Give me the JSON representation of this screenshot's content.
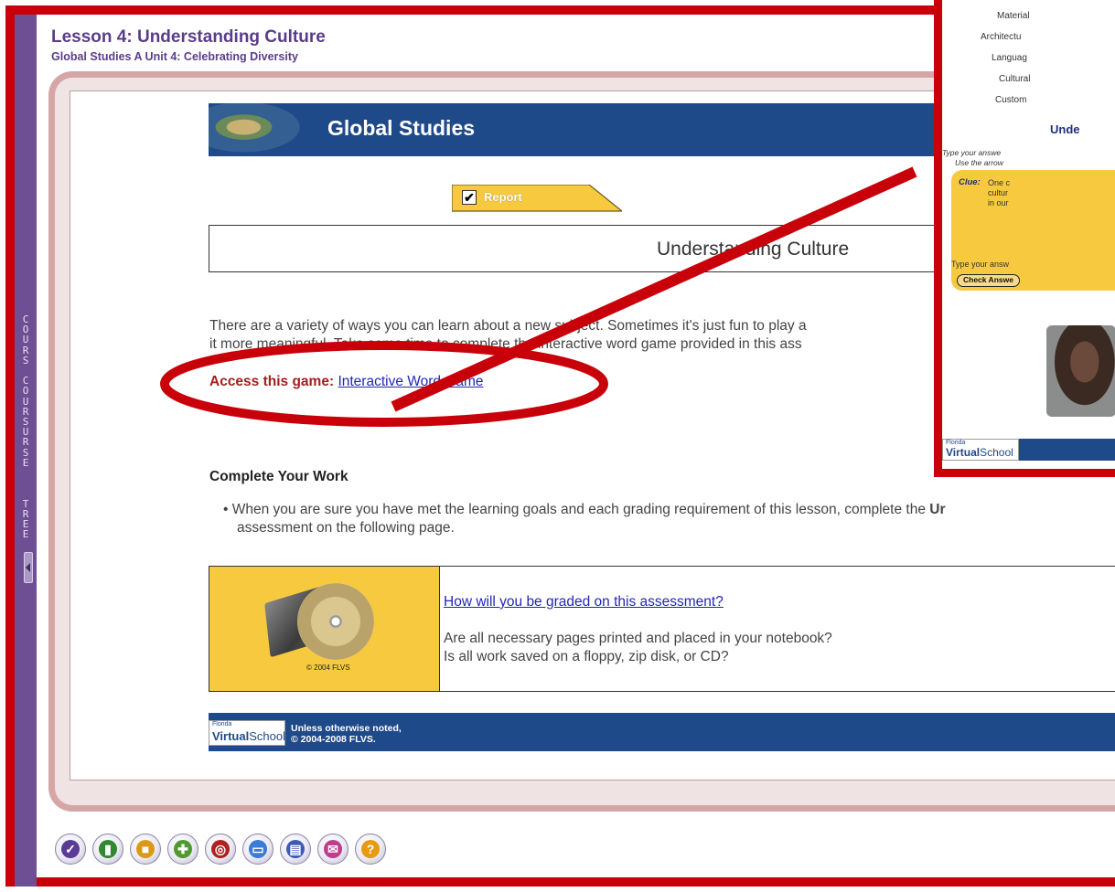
{
  "course_tree": {
    "label_letters": [
      "C",
      "O",
      "U",
      "R",
      "S",
      "",
      "C",
      "O",
      "U",
      "R",
      "S",
      "U",
      "R",
      "S",
      "E",
      "",
      "",
      "",
      "T",
      "R",
      "E",
      "E"
    ]
  },
  "lesson": {
    "title": "Lesson 4: Understanding Culture",
    "subtitle": "Global Studies A  Unit 4: Celebrating Diversity"
  },
  "banner": {
    "title": "Global Studies"
  },
  "report_tab": {
    "label": "Report",
    "checkmark": "✔"
  },
  "section_title": "Understanding Culture",
  "intro": {
    "line1": "There are a variety of ways you can learn about a new subject. Sometimes it's just fun to play a",
    "line2": "it more meaningful. Take some time to complete the interactive word game provided in this ass"
  },
  "access": {
    "label": "Access this game:",
    "link": "Interactive Word Game"
  },
  "complete": {
    "heading": "Complete Your Work",
    "bullet_line1": "• When you are sure you have met the learning goals and each grading requirement of this lesson, complete the ",
    "bullet_bold": "Ur",
    "bullet_line2": "assessment on the following page."
  },
  "grading": {
    "link": "How will you be graded on this assessment?",
    "q1": "Are all necessary pages printed and placed in your notebook?",
    "q2": "Is all work saved on a floppy, zip disk, or CD?",
    "copyright": "© 2004 FLVS"
  },
  "footer": {
    "logo_small": "Florida",
    "logo_big_bold": "Virtual",
    "logo_big_rest": "School",
    "note1": "Unless otherwise noted,",
    "note2": "© 2004-2008 FLVS."
  },
  "toolbar": {
    "buttons": [
      {
        "icon": "checkmark-icon",
        "glyph": "✓",
        "color": "#5b3b96"
      },
      {
        "icon": "book-icon",
        "glyph": "▮",
        "color": "#2f8a2f"
      },
      {
        "icon": "backpack-icon",
        "glyph": "■",
        "color": "#d99a1a"
      },
      {
        "icon": "puzzle-icon",
        "glyph": "✚",
        "color": "#4f9a2e"
      },
      {
        "icon": "target-icon",
        "glyph": "◎",
        "color": "#b02020"
      },
      {
        "icon": "chat-icon",
        "glyph": "▭",
        "color": "#3a7bd5"
      },
      {
        "icon": "printer-icon",
        "glyph": "▤",
        "color": "#3b5bb5"
      },
      {
        "icon": "mail-icon",
        "glyph": "✉",
        "color": "#c03d8e"
      },
      {
        "icon": "help-icon",
        "glyph": "?",
        "color": "#e79a12"
      }
    ]
  },
  "inset": {
    "rows": [
      "Material",
      "Architectu",
      "Languag",
      "Cultural",
      "Custom"
    ],
    "under_title": "Unde",
    "instr1": "Type your answe",
    "instr2": "Use the arrow",
    "clue_label": "Clue:",
    "clue_lines": [
      "One c",
      "cultur",
      "in our"
    ],
    "type_prompt": "Type your answ",
    "check_button": "Check Answe"
  },
  "colors": {
    "annotation_red": "#c8000a",
    "brand_navy": "#1f4a89",
    "lesson_purple": "#5a3d8a",
    "gold": "#f6c93f"
  }
}
